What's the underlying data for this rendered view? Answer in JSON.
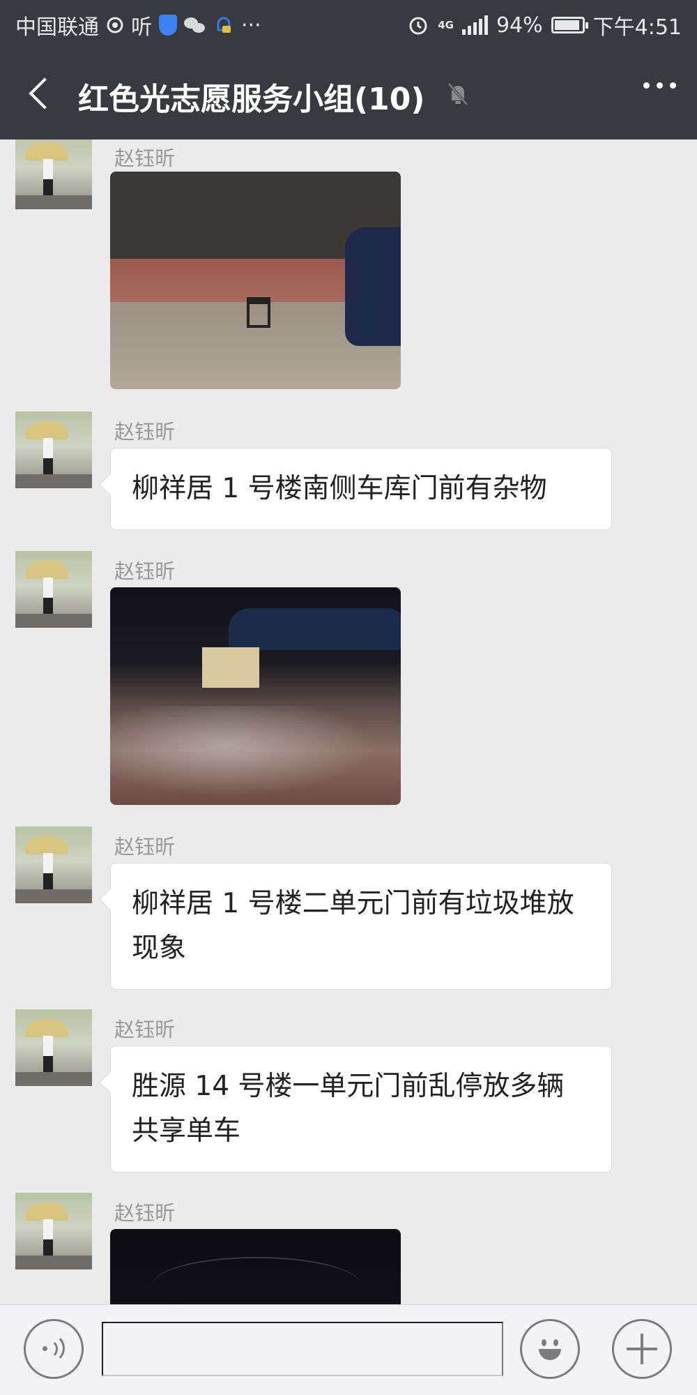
{
  "status_bar": {
    "carrier": "中国联通",
    "extra_app": "听",
    "network_label": "4G",
    "battery_text": "94%",
    "battery_level": 0.94,
    "time": "下午4:51",
    "overflow": "···"
  },
  "header": {
    "title": "红色光志愿服务小组(10)",
    "muted": true
  },
  "messages": [
    {
      "sender": "赵钰昕",
      "type": "image",
      "image_desc": "photo"
    },
    {
      "sender": "赵钰昕",
      "type": "text",
      "text": "柳祥居 1 号楼南侧车库门前有杂物"
    },
    {
      "sender": "赵钰昕",
      "type": "image",
      "image_desc": "photo"
    },
    {
      "sender": "赵钰昕",
      "type": "text",
      "text": "柳祥居 1 号楼二单元门前有垃圾堆放现象"
    },
    {
      "sender": "赵钰昕",
      "type": "text",
      "text": "胜源 14 号楼一单元门前乱停放多辆共享单车"
    },
    {
      "sender": "赵钰昕",
      "type": "image",
      "image_desc": "photo"
    }
  ],
  "input_bar": {
    "voice_icon": "voice-icon",
    "emoji_icon": "emoji-icon",
    "plus_icon": "plus-icon",
    "text_value": ""
  }
}
